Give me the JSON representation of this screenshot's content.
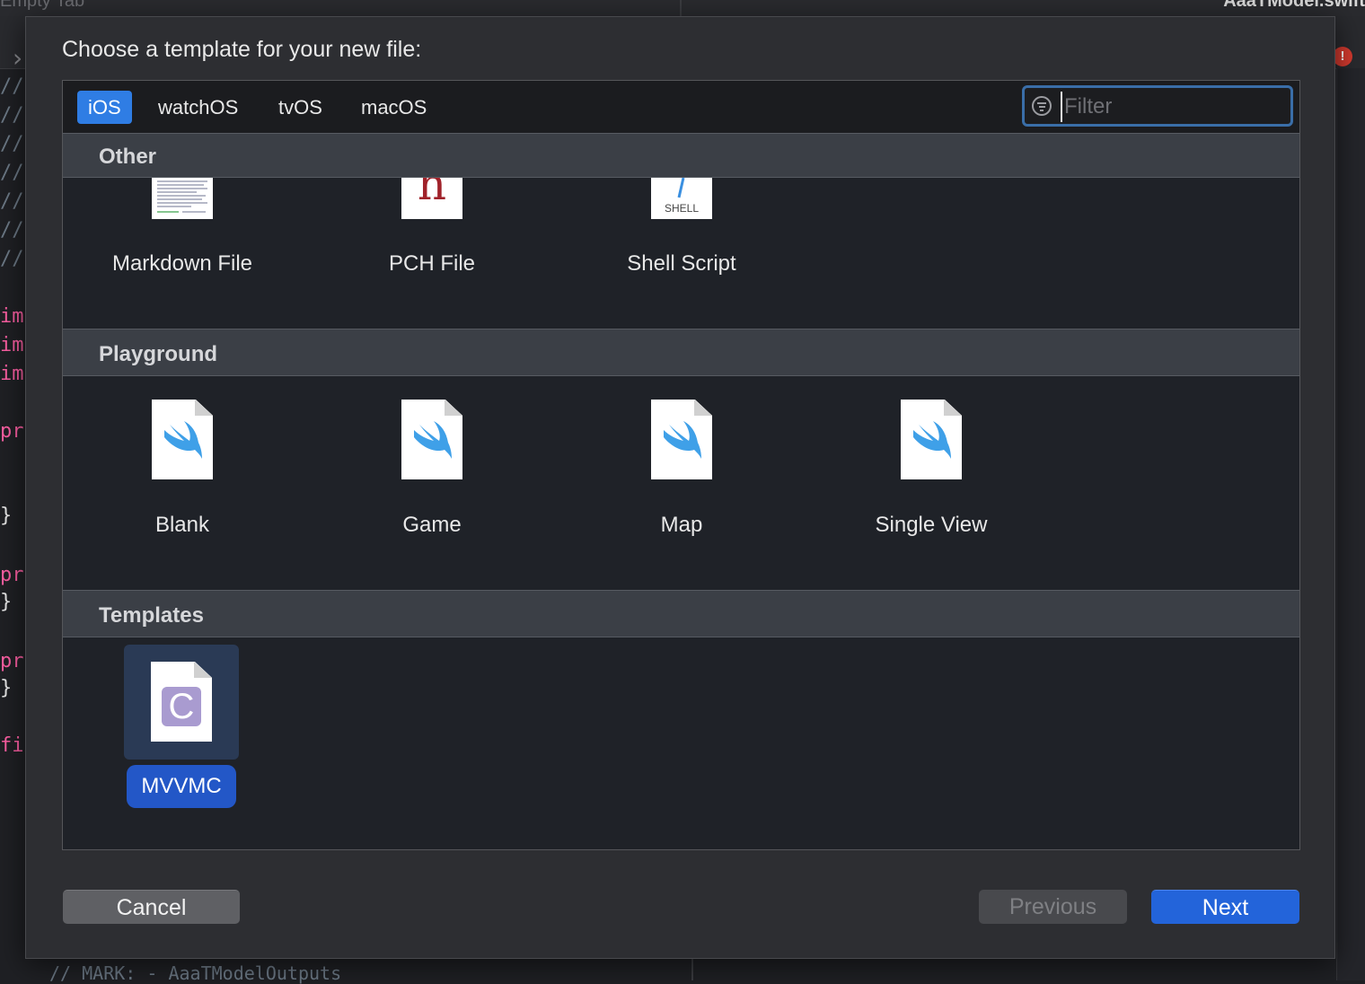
{
  "editor": {
    "tab_left": "Empty Tab",
    "tab_right": "AaaTModel.swift",
    "code_lines": [
      {
        "text": "//",
        "kind": "comment"
      },
      {
        "text": "//",
        "kind": "comment"
      },
      {
        "text": "//",
        "kind": "comment"
      },
      {
        "text": "//",
        "kind": "comment"
      },
      {
        "text": "//",
        "kind": "comment"
      },
      {
        "text": "//",
        "kind": "comment"
      },
      {
        "text": "//",
        "kind": "comment"
      },
      {
        "text": "im",
        "kind": "keyword"
      },
      {
        "text": "im",
        "kind": "keyword"
      },
      {
        "text": "im",
        "kind": "keyword"
      },
      {
        "text": "pr",
        "kind": "keyword"
      },
      {
        "text": "}",
        "kind": "plain"
      },
      {
        "text": "pr",
        "kind": "keyword"
      },
      {
        "text": "}",
        "kind": "plain"
      },
      {
        "text": "pr",
        "kind": "keyword"
      },
      {
        "text": "}",
        "kind": "plain"
      },
      {
        "text": "fi",
        "kind": "keyword"
      }
    ],
    "bottom_code": "// MARK: - AaaTModelOutputs"
  },
  "dialog": {
    "title": "Choose a template for your new file:",
    "platform_tabs": [
      {
        "label": "iOS",
        "active": true
      },
      {
        "label": "watchOS",
        "active": false
      },
      {
        "label": "tvOS",
        "active": false
      },
      {
        "label": "macOS",
        "active": false
      }
    ],
    "filter": {
      "placeholder": "Filter",
      "value": ""
    },
    "sections": [
      {
        "title": "Other",
        "items": [
          {
            "label": "Markdown File",
            "icon": "markdown-file-icon"
          },
          {
            "label": "PCH File",
            "icon": "pch-file-icon",
            "glyph": "h"
          },
          {
            "label": "Shell Script",
            "icon": "shell-script-icon",
            "glyph": "SHELL"
          }
        ]
      },
      {
        "title": "Playground",
        "items": [
          {
            "label": "Blank",
            "icon": "swift-playground-icon"
          },
          {
            "label": "Game",
            "icon": "swift-playground-icon"
          },
          {
            "label": "Map",
            "icon": "swift-playground-icon"
          },
          {
            "label": "Single View",
            "icon": "swift-playground-icon"
          }
        ]
      },
      {
        "title": "Templates",
        "items": [
          {
            "label": "MVVMC",
            "icon": "c-template-icon",
            "glyph": "C",
            "selected": true
          }
        ]
      }
    ],
    "buttons": {
      "cancel": "Cancel",
      "previous": "Previous",
      "next": "Next"
    },
    "colors": {
      "accent": "#2f7de4",
      "selection": "#2357c7",
      "next_button": "#2364da",
      "swift_bird": "#3fa0e8",
      "template_c": "#a99bd0"
    }
  }
}
